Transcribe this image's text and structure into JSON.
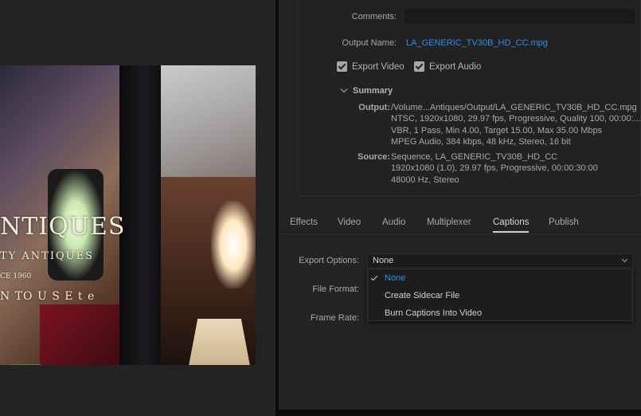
{
  "preview": {
    "sign_line1": "NTIQUES",
    "sign_line2": "TY ANTIQUES",
    "sign_line3": "CE 1960",
    "sign_line4": "N TO U S E  t e"
  },
  "export_settings": {
    "comments_label": "Comments:",
    "comments_value": "",
    "output_name_label": "Output Name:",
    "output_name_value": "LA_GENERIC_TV30B_HD_CC.mpg",
    "export_video_label": "Export Video",
    "export_video_checked": true,
    "export_audio_label": "Export Audio",
    "export_audio_checked": true
  },
  "summary": {
    "heading": "Summary",
    "output_label": "Output:",
    "output_lines": [
      "/Volume...Antiques/Output/LA_GENERIC_TV30B_HD_CC.mpg",
      "NTSC, 1920x1080, 29.97 fps, Progressive, Quality 100, 00:00:...",
      "VBR, 1 Pass, Min 4.00, Target 15.00, Max 35.00 Mbps",
      "MPEG Audio, 384 kbps, 48 kHz, Stereo, 16 bit"
    ],
    "source_label": "Source:",
    "source_lines": [
      "Sequence, LA_GENERIC_TV30B_HD_CC",
      "1920x1080 (1.0), 29.97 fps, Progressive, 00:00:30:00",
      "48000 Hz, Stereo"
    ]
  },
  "tabs": [
    {
      "label": "Effects"
    },
    {
      "label": "Video"
    },
    {
      "label": "Audio"
    },
    {
      "label": "Multiplexer"
    },
    {
      "label": "Captions",
      "active": true
    },
    {
      "label": "Publish"
    }
  ],
  "captions": {
    "export_options_label": "Export Options:",
    "export_options_value": "None",
    "file_format_label": "File Format:",
    "frame_rate_label": "Frame Rate:",
    "menu_options": [
      "None",
      "Create Sidecar File",
      "Burn Captions Into Video"
    ],
    "menu_selected": "None"
  },
  "colors": {
    "link": "#2d8ceb",
    "background": "#232323",
    "text": "#a8a8a8"
  },
  "icons": {
    "checkbox": "checkmark-icon",
    "summary_toggle": "chevron-down-icon",
    "dropdown": "chevron-down-icon",
    "menu_check": "checkmark-icon"
  }
}
